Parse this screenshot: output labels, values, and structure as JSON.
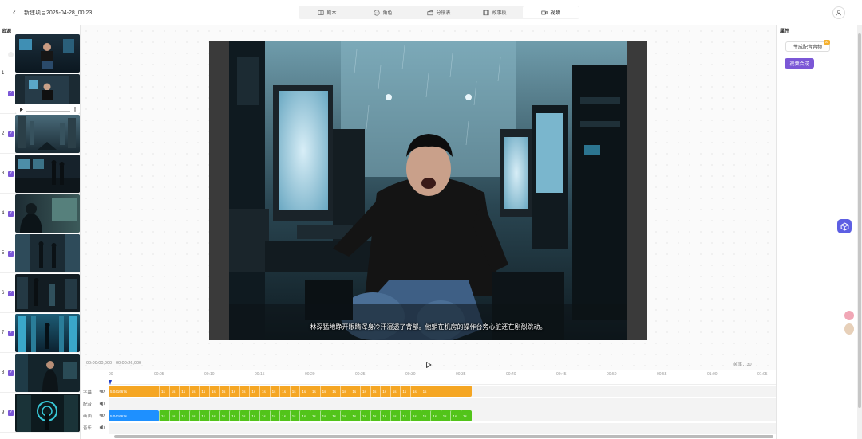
{
  "header": {
    "back_icon": "chevron-left-icon",
    "project_title": "新建项目2025-04-28_00:23",
    "tabs": [
      {
        "label": "剧本",
        "icon": "book-icon"
      },
      {
        "label": "角色",
        "icon": "smile-icon"
      },
      {
        "label": "分镜表",
        "icon": "clapper-icon"
      },
      {
        "label": "故事板",
        "icon": "film-icon"
      },
      {
        "label": "视频",
        "icon": "video-icon",
        "active": true
      }
    ],
    "user_icon": "user-icon"
  },
  "assets": {
    "title": "资源",
    "rows": [
      {
        "num": "1",
        "checked": true
      },
      {
        "num": "2",
        "checked": true
      },
      {
        "num": "3",
        "checked": true
      },
      {
        "num": "4",
        "checked": true
      },
      {
        "num": "5",
        "checked": true
      },
      {
        "num": "6",
        "checked": true
      },
      {
        "num": "7",
        "checked": true
      },
      {
        "num": "8",
        "checked": true
      },
      {
        "num": "9",
        "checked": true
      }
    ]
  },
  "preview": {
    "subtitle": "林深猛地睁开眼睛浑身冷汗湿透了背部。他躺在机房的操作台旁心脏还在剧烈跳动。",
    "time_range": "00:00:00,000 - 00:00:26,000",
    "fps": "帧率：30",
    "play_icon": "play-icon"
  },
  "properties": {
    "title": "属性",
    "gen_audio_label": "生成配音音频",
    "gen_audio_badge": "AI",
    "compose_label": "视频合成"
  },
  "timeline": {
    "ticks": [
      "00",
      "00:05",
      "00:10",
      "00:15",
      "00:20",
      "00:25",
      "00:30",
      "00:35",
      "00:40",
      "00:45",
      "00:50",
      "00:55",
      "01:00",
      "01:05"
    ],
    "tracks": [
      {
        "label": "字幕",
        "icon": "eye-icon"
      },
      {
        "label": "配音",
        "icon": "volume-icon"
      },
      {
        "label": "画面",
        "icon": "eye-icon"
      },
      {
        "label": "音乐",
        "icon": "volume-icon"
      }
    ],
    "subtitle_clip_label": "5.041667s",
    "video_clip_label": "5.041667s",
    "segment_label": "1s",
    "segment_count": 31
  },
  "colors": {
    "accent": "#7b57d6",
    "subtitle_track": "#f5a623",
    "video_first": "#1e90ff",
    "video_segments": "#52c41a"
  }
}
